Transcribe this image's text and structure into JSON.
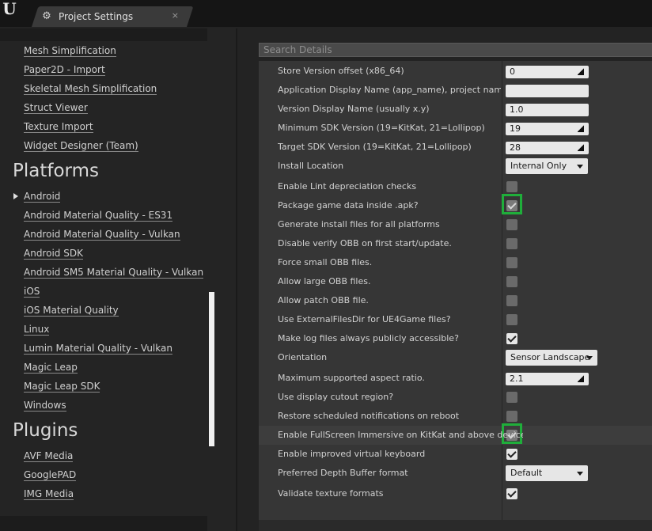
{
  "window": {
    "logo": "U",
    "tab_title": "Project Settings",
    "tab_icon": "gear-icon",
    "tab_close": "×"
  },
  "sidebar": {
    "items_top": [
      {
        "label": "Mesh Simplification"
      },
      {
        "label": "Paper2D - Import"
      },
      {
        "label": "Skeletal Mesh Simplification"
      },
      {
        "label": "Struct Viewer"
      },
      {
        "label": "Texture Import"
      },
      {
        "label": "Widget Designer (Team)"
      }
    ],
    "platforms_header": "Platforms",
    "platforms": [
      {
        "label": "Android",
        "active": true
      },
      {
        "label": "Android Material Quality - ES31"
      },
      {
        "label": "Android Material Quality - Vulkan"
      },
      {
        "label": "Android SDK"
      },
      {
        "label": "Android SM5 Material Quality - Vulkan"
      },
      {
        "label": "iOS"
      },
      {
        "label": "iOS Material Quality"
      },
      {
        "label": "Linux"
      },
      {
        "label": "Lumin Material Quality - Vulkan"
      },
      {
        "label": "Magic Leap"
      },
      {
        "label": "Magic Leap SDK"
      },
      {
        "label": "Windows"
      }
    ],
    "plugins_header": "Plugins",
    "plugins": [
      {
        "label": "AVF Media"
      },
      {
        "label": "GooglePAD"
      },
      {
        "label": "IMG Media"
      }
    ]
  },
  "details": {
    "search_placeholder": "Search Details",
    "rows": [
      {
        "label": "Store Version offset (x86_64)",
        "kind": "spin",
        "value": "0"
      },
      {
        "label": "Application Display Name (app_name), project name if bl",
        "kind": "text",
        "value": ""
      },
      {
        "label": "Version Display Name (usually x.y)",
        "kind": "text",
        "value": "1.0"
      },
      {
        "label": "Minimum SDK Version (19=KitKat, 21=Lollipop)",
        "kind": "spin",
        "value": "19"
      },
      {
        "label": "Target SDK Version (19=KitKat, 21=Lollipop)",
        "kind": "spin",
        "value": "28"
      },
      {
        "label": "Install Location",
        "kind": "dropdown",
        "value": "Internal Only"
      },
      {
        "label": "Enable Lint depreciation checks",
        "kind": "check",
        "checked": false
      },
      {
        "label": "Package game data inside .apk?",
        "kind": "check",
        "checked": true,
        "highlight": true,
        "dim": true
      },
      {
        "label": "Generate install files for all platforms",
        "kind": "check",
        "checked": false
      },
      {
        "label": "Disable verify OBB on first start/update.",
        "kind": "check",
        "checked": false
      },
      {
        "label": "Force small OBB files.",
        "kind": "check",
        "checked": false
      },
      {
        "label": "Allow large OBB files.",
        "kind": "check",
        "checked": false
      },
      {
        "label": "Allow patch OBB file.",
        "kind": "check",
        "checked": false
      },
      {
        "label": "Use ExternalFilesDir for UE4Game files?",
        "kind": "check",
        "checked": false
      },
      {
        "label": "Make log files always publicly accessible?",
        "kind": "check",
        "checked": true
      },
      {
        "label": "Orientation",
        "kind": "dropdown",
        "value": "Sensor Landscape"
      },
      {
        "label": "Maximum supported aspect ratio.",
        "kind": "spin",
        "value": "2.1"
      },
      {
        "label": "Use display cutout region?",
        "kind": "check",
        "checked": false
      },
      {
        "label": "Restore scheduled notifications on reboot",
        "kind": "check",
        "checked": false
      },
      {
        "label": "Enable FullScreen Immersive on KitKat and above devices",
        "kind": "check",
        "checked": true,
        "highlight": true,
        "dim": true,
        "rowhl": true
      },
      {
        "label": "Enable improved virtual keyboard",
        "kind": "check",
        "checked": true
      },
      {
        "label": "Preferred Depth Buffer format",
        "kind": "dropdown",
        "value": "Default"
      },
      {
        "label": "Validate texture formats",
        "kind": "check",
        "checked": true
      }
    ]
  },
  "colors": {
    "highlight_box": "#1fae3a",
    "panel_bg": "#363636"
  }
}
